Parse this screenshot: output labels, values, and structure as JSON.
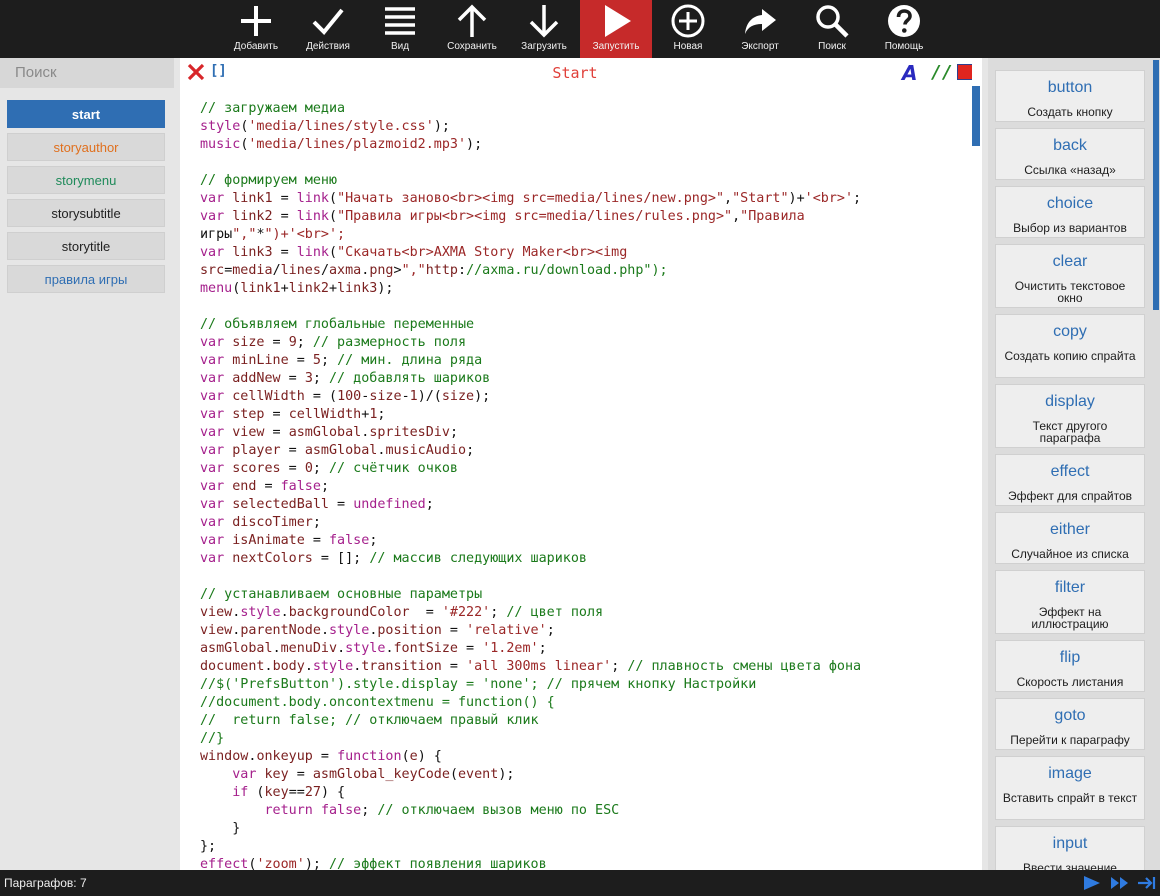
{
  "toolbar": {
    "buttons": [
      {
        "label": "Добавить",
        "icon": "plus-icon"
      },
      {
        "label": "Действия",
        "icon": "check-icon"
      },
      {
        "label": "Вид",
        "icon": "menu-icon"
      },
      {
        "label": "Сохранить",
        "icon": "arrow-up-icon"
      },
      {
        "label": "Загрузить",
        "icon": "arrow-down-icon"
      },
      {
        "label": "Запустить",
        "icon": "play-icon"
      },
      {
        "label": "Новая",
        "icon": "circle-plus-icon"
      },
      {
        "label": "Экспорт",
        "icon": "share-icon"
      },
      {
        "label": "Поиск",
        "icon": "search-icon"
      },
      {
        "label": "Помощь",
        "icon": "help-icon"
      }
    ],
    "active_color": "#c62a2a"
  },
  "sidebar": {
    "search_placeholder": "Поиск",
    "items": [
      {
        "label": "start",
        "color": "#ffffff"
      },
      {
        "label": "storyauthor",
        "color": "#e0701e"
      },
      {
        "label": "storymenu",
        "color": "#1f8a5a"
      },
      {
        "label": "storysubtitle",
        "color": "#222222"
      },
      {
        "label": "storytitle",
        "color": "#222222"
      },
      {
        "label": "правила игры",
        "color": "#2f6eb3"
      }
    ]
  },
  "editor": {
    "title": "Start",
    "bracket_label": "[]",
    "font_label": "A",
    "comment_label": "//"
  },
  "code_lines": [
    "// загружаем медиа",
    "style('media/lines/style.css');",
    "music('media/lines/plazmoid2.mp3');",
    "",
    "// формируем меню",
    "var link1 = link(\"Начать заново<br><img src=media/lines/new.png>\",\"Start\")+'<br>';",
    "var link2 = link(\"Правила игры<br><img src=media/lines/rules.png>\",\"Правила",
    "игры\",\"*\")+'<br>';",
    "var link3 = link(\"Скачать<br>AXMA Story Maker<br><img",
    "src=media/lines/axma.png>\",\"http://axma.ru/download.php\");",
    "menu(link1+link2+link3);",
    "",
    "// объявляем глобальные переменные",
    "var size = 9; // размерность поля",
    "var minLine = 5; // мин. длина ряда",
    "var addNew = 3; // добавлять шариков",
    "var cellWidth = (100-size-1)/(size);",
    "var step = cellWidth+1;",
    "var view = asmGlobal.spritesDiv;",
    "var player = asmGlobal.musicAudio;",
    "var scores = 0; // счётчик очков",
    "var end = false;",
    "var selectedBall = undefined;",
    "var discoTimer;",
    "var isAnimate = false;",
    "var nextColors = []; // массив следующих шариков",
    "",
    "// устанавливаем основные параметры",
    "view.style.backgroundColor  = '#222'; // цвет поля",
    "view.parentNode.style.position = 'relative';",
    "asmGlobal.menuDiv.style.fontSize = '1.2em';",
    "document.body.style.transition = 'all 300ms linear'; // плавность смены цвета фона",
    "//$('PrefsButton').style.display = 'none'; // прячем кнопку Настройки",
    "//document.body.oncontextmenu = function() {",
    "//  return false; // отключаем правый клик",
    "//}",
    "window.onkeyup = function(e) {",
    "    var key = asmGlobal_keyCode(event);",
    "    if (key==27) {",
    "        return false; // отключаем вызов меню по ESC",
    "    }",
    "};",
    "effect('zoom'); // эффект появления шариков"
  ],
  "functions": [
    {
      "name": "button",
      "desc": "Создать кнопку"
    },
    {
      "name": "back",
      "desc": "Ссылка «назад»"
    },
    {
      "name": "choice",
      "desc": "Выбор из вариантов"
    },
    {
      "name": "clear",
      "desc": "Очистить текстовое окно"
    },
    {
      "name": "copy",
      "desc": "Создать копию спрайта"
    },
    {
      "name": "display",
      "desc": "Текст другого параграфа"
    },
    {
      "name": "effect",
      "desc": "Эффект для спрайтов"
    },
    {
      "name": "either",
      "desc": "Случайное из списка"
    },
    {
      "name": "filter",
      "desc": "Эффект на иллюстрацию"
    },
    {
      "name": "flip",
      "desc": "Скорость листания"
    },
    {
      "name": "goto",
      "desc": "Перейти к параграфу"
    },
    {
      "name": "image",
      "desc": "Вставить спрайт в текст"
    },
    {
      "name": "input",
      "desc": "Ввести значение"
    }
  ],
  "status": {
    "text": "Параграфов: 7",
    "icons": [
      "play-icon",
      "fast-forward-icon",
      "arrow-to-end-icon"
    ]
  }
}
